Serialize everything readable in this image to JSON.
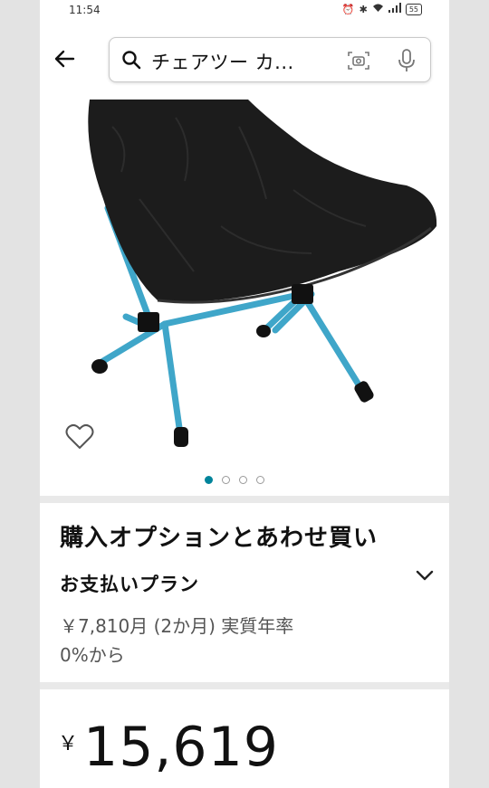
{
  "status_bar": {
    "time": "11:54",
    "battery": "55"
  },
  "search": {
    "query": "チェアツー カ..."
  },
  "product": {
    "carousel": {
      "total": 4,
      "active_index": 0
    }
  },
  "purchase_options": {
    "title": "購入オプションとあわせ買い",
    "plan_label": "お支払いプラン",
    "plan_detail_line1": "￥7,810月 (2か月) 実質年率",
    "plan_detail_line2": "0%から"
  },
  "price": {
    "currency": "￥",
    "value": "15,619"
  },
  "colors": {
    "accent": "#00849b",
    "chair_frame": "#3fa6c9",
    "fleece": "#1c1c1c"
  },
  "icons": [
    "back-arrow-icon",
    "search-icon",
    "camera-icon",
    "mic-icon",
    "heart-icon",
    "chevron-down-icon"
  ]
}
